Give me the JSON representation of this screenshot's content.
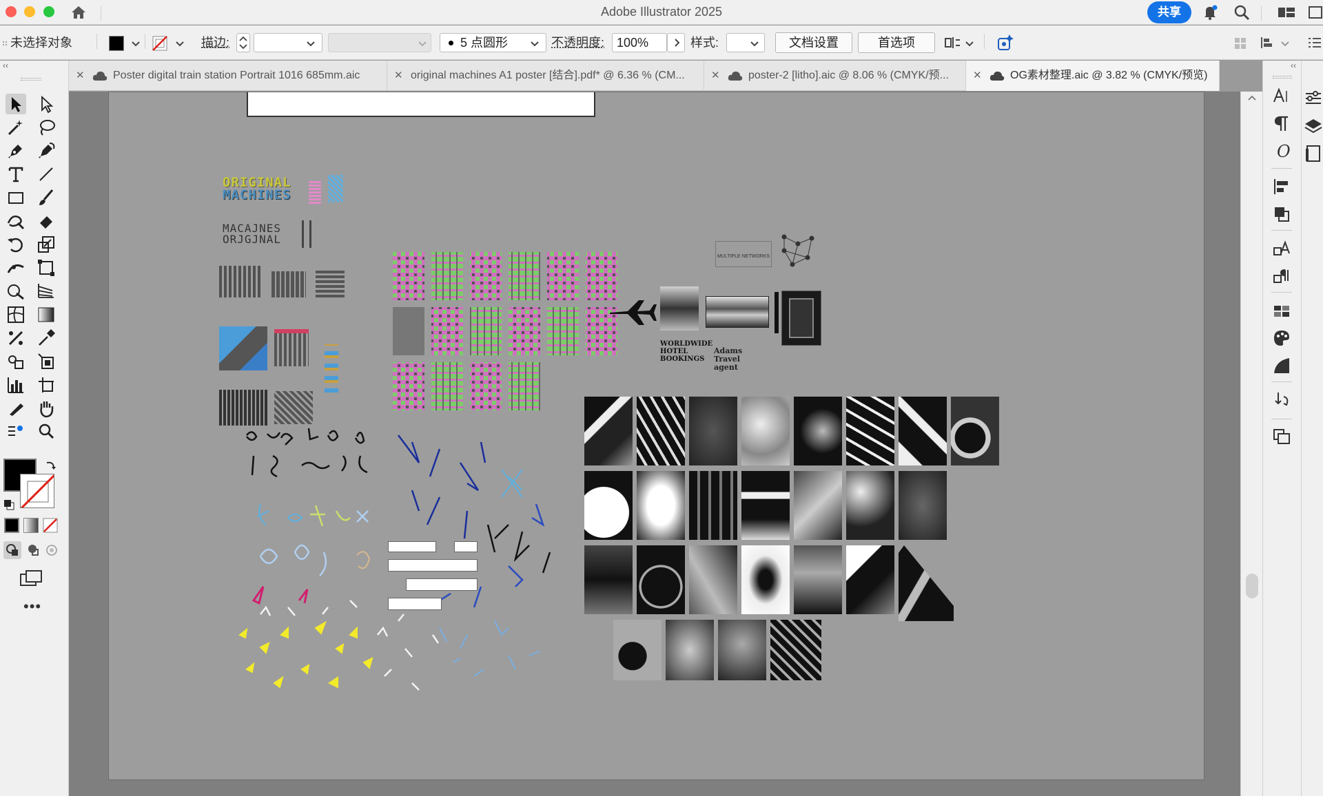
{
  "app": {
    "title": "Adobe Illustrator 2025",
    "share_label": "共享"
  },
  "control_bar": {
    "selection_status": "未选择对象",
    "stroke_label": "描边:",
    "brush_label": "5 点圆形",
    "opacity_label": "不透明度:",
    "opacity_value": "100%",
    "style_label": "样式:",
    "doc_setup_button": "文档设置",
    "preferences_button": "首选项"
  },
  "tabs": [
    {
      "label": "Poster digital train station Portrait 1016  685mm.aic",
      "active": false,
      "cloud": true
    },
    {
      "label": "original machines A1 poster [结合].pdf* @ 6.36 % (CM...",
      "active": false,
      "cloud": false
    },
    {
      "label": "poster-2 [litho].aic @ 8.06 % (CMYK/预...",
      "active": false,
      "cloud": true
    },
    {
      "label": "OG素材整理.aic @ 3.82 % (CMYK/预览)",
      "active": true,
      "cloud": true
    }
  ],
  "artwork_text": {
    "logo_line1": "ORIGINAL",
    "logo_line2": "MACHINES",
    "logo_alt1": "MACAJNES",
    "logo_alt2": "ORJGJNAL",
    "multiple_networks": "MULTIPLE NETWORKS",
    "worldwide": "WORLDWIDE HOTEL BOOKINGS",
    "adams": "Adams Travel agent"
  },
  "colors": {
    "accent": "#1473e6",
    "pink": "#d070c0",
    "green": "#7ccc6a",
    "yellow": "#f2ea2a"
  }
}
